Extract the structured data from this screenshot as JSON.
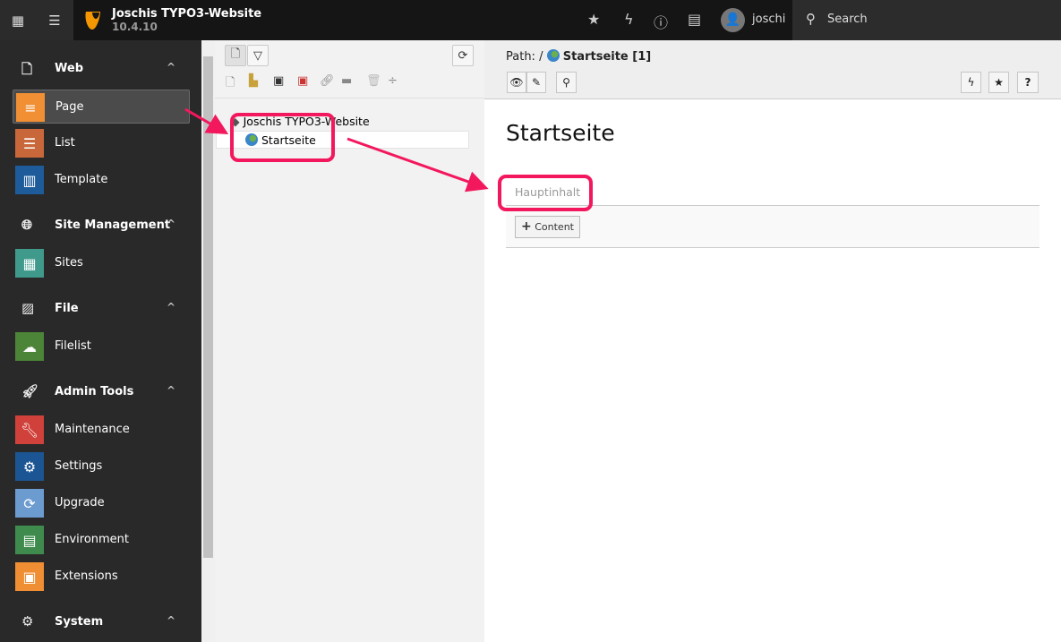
{
  "topbar": {
    "site_name": "Joschis TYPO3-Website",
    "version": "10.4.10",
    "username": "joschi",
    "search_label": "Search",
    "icons": [
      "module-menu-icon",
      "pagetree-toggle-icon",
      "bookmark-star-icon",
      "flash-icon",
      "help-icon",
      "system-info-icon"
    ]
  },
  "sidebar": {
    "groups": [
      {
        "label": "Web",
        "icon": "page-icon",
        "modules": [
          {
            "label": "Page",
            "color": "#f18f35",
            "active": true
          },
          {
            "label": "List",
            "color": "#c8683a"
          },
          {
            "label": "Template",
            "color": "#1e5b9b"
          }
        ]
      },
      {
        "label": "Site Management",
        "icon": "globe-icon",
        "modules": [
          {
            "label": "Sites",
            "color": "#3f9a8c"
          }
        ]
      },
      {
        "label": "File",
        "icon": "image-icon",
        "modules": [
          {
            "label": "Filelist",
            "color": "#4c8438"
          }
        ]
      },
      {
        "label": "Admin Tools",
        "icon": "rocket-icon",
        "modules": [
          {
            "label": "Maintenance",
            "color": "#d0413b"
          },
          {
            "label": "Settings",
            "color": "#1b5593"
          },
          {
            "label": "Upgrade",
            "color": "#6c9bd0"
          },
          {
            "label": "Environment",
            "color": "#3f8b4d"
          },
          {
            "label": "Extensions",
            "color": "#f08e33"
          }
        ]
      },
      {
        "label": "System",
        "icon": "gear-icon",
        "modules": []
      }
    ]
  },
  "tree": {
    "root": "Joschis TYPO3-Website",
    "page": "Startseite"
  },
  "content": {
    "path_label": "Path: /",
    "path_page": "Startseite [1]",
    "title": "Startseite",
    "column": "Hauptinhalt",
    "add_content": "Content"
  },
  "annotation_color": "#f3185e"
}
